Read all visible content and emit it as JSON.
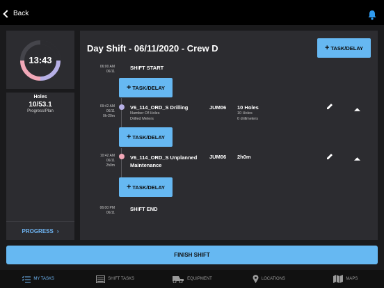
{
  "topbar": {
    "back_label": "Back"
  },
  "clock": {
    "time": "13:43"
  },
  "holes": {
    "title": "Holes",
    "value": "10/53.1",
    "subtitle": "Progress/Plan",
    "progress_link": "PROGRESS"
  },
  "shift": {
    "title": "Day Shift - 06/11/2020 - Crew D",
    "task_button": "TASK/DELAY"
  },
  "timeline": {
    "start": {
      "time": "06:00 AM",
      "date": "06/11",
      "label": "SHIFT START"
    },
    "task1": {
      "time": "09:42 AM",
      "date": "06/11",
      "duration": "0h-20m",
      "name": "V6_114_ORD_S Drilling",
      "sub1": "Number Of Holes",
      "sub2": "Drilled Meters",
      "equipment": "JUM06",
      "value": "10 Holes",
      "value_sub1": "10 Holes",
      "value_sub2": "0 drillmeters",
      "dot_color": "#b7b0e6"
    },
    "task2": {
      "time": "10:42 AM",
      "date": "06/11",
      "duration": "2h0m",
      "name_line1": "V6_114_ORD_S Unplanned",
      "name_line2": "Maintenance",
      "equipment": "JUM06",
      "value": "2h0m",
      "dot_color": "#f2a8b8"
    },
    "end": {
      "time": "06:00 PM",
      "date": "06/11",
      "label": "SHIFT END"
    },
    "add_label": "TASK/DELAY"
  },
  "finish": {
    "label": "FINISH SHIFT"
  },
  "tabs": [
    {
      "label": "MY TASKS",
      "icon": "list-check-icon",
      "active": true
    },
    {
      "label": "SHIFT TASKS",
      "icon": "list-box-icon",
      "active": false
    },
    {
      "label": "EQUIPMENT",
      "icon": "truck-icon",
      "active": false
    },
    {
      "label": "LOCATIONS",
      "icon": "pin-icon",
      "active": false
    },
    {
      "label": "MAPS",
      "icon": "map-icon",
      "active": false
    }
  ],
  "colors": {
    "accent": "#66b8f2",
    "panel": "#2c2c30",
    "background": "#1a1a1c"
  }
}
